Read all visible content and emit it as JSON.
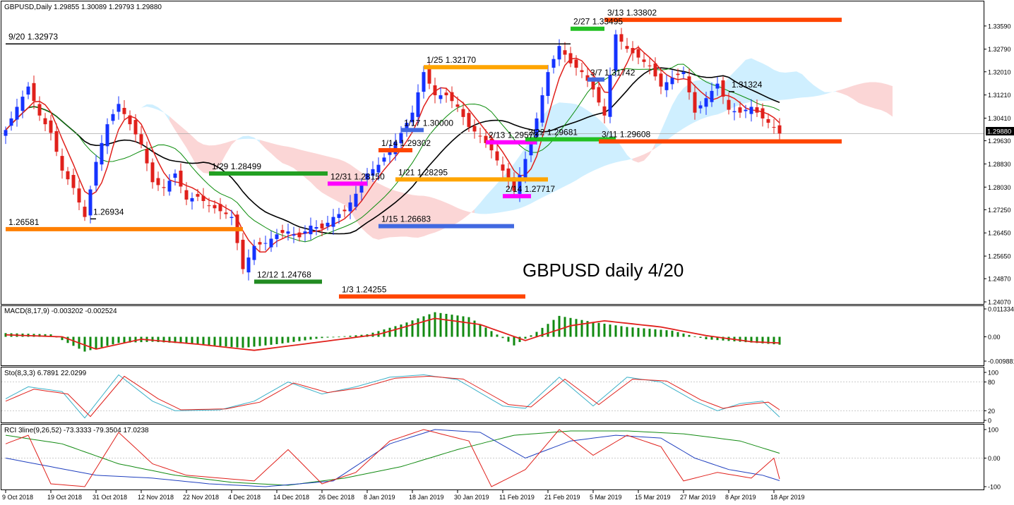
{
  "colors": {
    "bull": "#1533ff",
    "bear": "#e0201b",
    "tenkan": "#e0201b",
    "kijun": "#0b8c0b",
    "ma": "#000000",
    "kumo_bull": "#cfefff",
    "kumo_bear": "#fbd6d6",
    "macd_hist": "#118a11",
    "macd_signal": "#e0201b",
    "sto_k": "#3ab0c8",
    "sto_d": "#e0201b",
    "rci_short": "#e0201b",
    "rci_mid": "#1f3fbf",
    "rci_long": "#118a11"
  },
  "header": {
    "main": "GBPUSD,Daily  1.29855 1.30089 1.29793 1.29880",
    "macd": "MACD(8,17,9) -0.003202 -0.002524",
    "sto": "Sto(8,3,3) 6.7891 22.0299",
    "rci": "RCI 3line(9,26,52) -73.3333 -79.3504 17.0238"
  },
  "watermark": "GBPUSD daily 4/20",
  "current_price": "1.29880",
  "chart_data": [
    {
      "type": "candlestick",
      "panel": "main",
      "ylim": [
        1.2407,
        1.34
      ],
      "y_ticks": [
        "1.33590",
        "1.32790",
        "1.32010",
        "1.31210",
        "1.30410",
        "1.29630",
        "1.28830",
        "1.28030",
        "1.27250",
        "1.26450",
        "1.25650",
        "1.24870",
        "1.24070"
      ],
      "tick_values": [
        1.3359,
        1.3279,
        1.3201,
        1.3121,
        1.3041,
        1.2963,
        1.2883,
        1.2803,
        1.2725,
        1.2645,
        1.2565,
        1.2487,
        1.2407
      ],
      "x_ticks": [
        "9 Oct 2018",
        "19 Oct 2018",
        "31 Oct 2018",
        "12 Nov 2018",
        "22 Nov 2018",
        "4 Dec 2018",
        "14 Dec 2018",
        "26 Dec 2018",
        "8 Jan 2019",
        "18 Jan 2019",
        "30 Jan 2019",
        "11 Feb 2019",
        "21 Feb 2019",
        "5 Mar 2019",
        "15 Mar 2019",
        "27 Mar 2019",
        "8 Apr 2019",
        "18 Apr 2019"
      ],
      "x_tick_index": [
        0,
        8,
        16,
        24,
        32,
        40,
        48,
        56,
        64,
        72,
        80,
        88,
        96,
        104,
        112,
        120,
        128,
        136
      ],
      "close_path": [
        [
          0,
          1.3
        ],
        [
          2,
          1.308
        ],
        [
          4,
          1.315
        ],
        [
          6,
          1.305
        ],
        [
          8,
          1.299
        ],
        [
          10,
          1.286
        ],
        [
          12,
          1.28
        ],
        [
          14,
          1.27
        ],
        [
          16,
          1.289
        ],
        [
          18,
          1.302
        ],
        [
          20,
          1.309
        ],
        [
          22,
          1.302
        ],
        [
          24,
          1.295
        ],
        [
          26,
          1.282
        ],
        [
          28,
          1.28
        ],
        [
          30,
          1.285
        ],
        [
          32,
          1.276
        ],
        [
          34,
          1.277
        ],
        [
          36,
          1.274
        ],
        [
          38,
          1.272
        ],
        [
          40,
          1.27
        ],
        [
          42,
          1.252
        ],
        [
          44,
          1.26
        ],
        [
          46,
          1.261
        ],
        [
          48,
          1.264
        ],
        [
          50,
          1.265
        ],
        [
          52,
          1.263
        ],
        [
          54,
          1.267
        ],
        [
          56,
          1.266
        ],
        [
          58,
          1.27
        ],
        [
          60,
          1.272
        ],
        [
          62,
          1.278
        ],
        [
          64,
          1.285
        ],
        [
          66,
          1.288
        ],
        [
          68,
          1.293
        ],
        [
          70,
          1.299
        ],
        [
          72,
          1.306
        ],
        [
          74,
          1.32
        ],
        [
          76,
          1.312
        ],
        [
          78,
          1.312
        ],
        [
          80,
          1.308
        ],
        [
          82,
          1.301
        ],
        [
          84,
          1.298
        ],
        [
          86,
          1.293
        ],
        [
          88,
          1.286
        ],
        [
          90,
          1.279
        ],
        [
          92,
          1.29
        ],
        [
          94,
          1.304
        ],
        [
          96,
          1.32
        ],
        [
          98,
          1.329
        ],
        [
          100,
          1.323
        ],
        [
          102,
          1.32
        ],
        [
          104,
          1.314
        ],
        [
          106,
          1.305
        ],
        [
          108,
          1.333
        ],
        [
          110,
          1.328
        ],
        [
          112,
          1.325
        ],
        [
          114,
          1.322
        ],
        [
          116,
          1.315
        ],
        [
          118,
          1.318
        ],
        [
          120,
          1.32
        ],
        [
          122,
          1.306
        ],
        [
          124,
          1.311
        ],
        [
          126,
          1.316
        ],
        [
          128,
          1.307
        ],
        [
          130,
          1.306
        ],
        [
          132,
          1.308
        ],
        [
          134,
          1.304
        ],
        [
          136,
          1.301
        ],
        [
          137,
          1.2988
        ]
      ],
      "levels": [
        {
          "label": "9/20 1.32973",
          "value": 1.32973,
          "from": 0,
          "to": 100,
          "color": "#000000"
        },
        {
          "label": "3/13 1.33802",
          "value": 1.33802,
          "from": 106,
          "to": 148,
          "color": "#ff4500"
        },
        {
          "label": "2/27 1.33495",
          "value": 1.33495,
          "from": 100,
          "to": 106,
          "color": "#22c022"
        },
        {
          "label": "1/25 1.32170",
          "value": 1.3217,
          "from": 74,
          "to": 96,
          "color": "#ffa500"
        },
        {
          "label": "3/7 1.31742",
          "value": 1.31742,
          "from": 103,
          "to": 106,
          "color": "#4169e1"
        },
        {
          "label": "1.31324",
          "value": 1.31324,
          "from": 128,
          "to": 129,
          "color": "#000000"
        },
        {
          "label": "1/17 1.30000",
          "value": 1.3,
          "from": 70,
          "to": 74,
          "color": "#4169e1"
        },
        {
          "label": "2/13 1.29578",
          "value": 1.29578,
          "from": 85,
          "to": 94,
          "color": "#ff00ff"
        },
        {
          "label": "2/22 1.29681",
          "value": 1.29681,
          "from": 92,
          "to": 108,
          "color": "#22c022"
        },
        {
          "label": "3/11 1.29608",
          "value": 1.29608,
          "from": 105,
          "to": 148,
          "color": "#ff4500"
        },
        {
          "label": "1/14 1.29302",
          "value": 1.29302,
          "from": 66,
          "to": 72,
          "color": "#ff4500"
        },
        {
          "label": "1/29 1.28499",
          "value": 1.28499,
          "from": 36,
          "to": 57,
          "color": "#22a022"
        },
        {
          "label": "1/21 1.28295",
          "value": 1.28295,
          "from": 69,
          "to": 96,
          "color": "#ffa500"
        },
        {
          "label": "12/31 1.28150",
          "value": 1.2815,
          "from": 57,
          "to": 64,
          "color": "#ff00ff"
        },
        {
          "label": "2/14 1.27717",
          "value": 1.27717,
          "from": 88,
          "to": 93,
          "color": "#ff00ff"
        },
        {
          "label": "1.26934",
          "value": 1.26934,
          "from": 15,
          "to": 16,
          "color": "#000000"
        },
        {
          "label": "1.26581",
          "value": 1.26581,
          "from": 0,
          "to": 42,
          "color": "#ff7f00"
        },
        {
          "label": "1/15 1.26683",
          "value": 1.26683,
          "from": 66,
          "to": 90,
          "color": "#4169e1"
        },
        {
          "label": "12/12 1.24768",
          "value": 1.24768,
          "from": 44,
          "to": 56,
          "color": "#228b22"
        },
        {
          "label": "1/3 1.24255",
          "value": 1.24255,
          "from": 59,
          "to": 92,
          "color": "#ff4500"
        }
      ]
    },
    {
      "type": "histogram",
      "panel": "macd",
      "ylim": [
        -0.009881,
        0.011334
      ],
      "y_ticks": [
        "0.011334",
        "0.00",
        "-0.009881"
      ],
      "tick_values": [
        0.011334,
        0,
        -0.009881
      ],
      "hist_path": [
        [
          0,
          0.0015
        ],
        [
          8,
          0.001
        ],
        [
          14,
          -0.006
        ],
        [
          20,
          -0.0025
        ],
        [
          26,
          -0.002
        ],
        [
          34,
          -0.003
        ],
        [
          42,
          -0.0045
        ],
        [
          48,
          -0.003
        ],
        [
          56,
          -0.0005
        ],
        [
          64,
          0.001
        ],
        [
          70,
          0.005
        ],
        [
          76,
          0.01
        ],
        [
          82,
          0.008
        ],
        [
          88,
          -0.0005
        ],
        [
          90,
          -0.0035
        ],
        [
          94,
          0.002
        ],
        [
          98,
          0.0085
        ],
        [
          104,
          0.006
        ],
        [
          110,
          0.004
        ],
        [
          118,
          0.0025
        ],
        [
          124,
          -0.001
        ],
        [
          130,
          -0.002
        ],
        [
          137,
          -0.0032
        ]
      ],
      "signal_path": [
        [
          0,
          0.0008
        ],
        [
          10,
          0.0
        ],
        [
          16,
          -0.005
        ],
        [
          24,
          -0.001
        ],
        [
          34,
          -0.003
        ],
        [
          44,
          -0.0055
        ],
        [
          56,
          -0.002
        ],
        [
          66,
          0.001
        ],
        [
          76,
          0.0075
        ],
        [
          84,
          0.005
        ],
        [
          92,
          -0.0015
        ],
        [
          100,
          0.0045
        ],
        [
          106,
          0.0065
        ],
        [
          116,
          0.004
        ],
        [
          124,
          0.0005
        ],
        [
          132,
          -0.002
        ],
        [
          137,
          -0.0025
        ]
      ]
    },
    {
      "type": "line",
      "panel": "sto",
      "ylim": [
        0,
        100
      ],
      "y_ticks": [
        "100",
        "80",
        "20",
        "0"
      ],
      "tick_values": [
        100,
        80,
        20,
        0
      ],
      "k_path": [
        [
          0,
          45
        ],
        [
          4,
          70
        ],
        [
          10,
          60
        ],
        [
          14,
          5
        ],
        [
          20,
          95
        ],
        [
          26,
          40
        ],
        [
          30,
          20
        ],
        [
          38,
          22
        ],
        [
          44,
          40
        ],
        [
          50,
          80
        ],
        [
          56,
          55
        ],
        [
          62,
          70
        ],
        [
          68,
          90
        ],
        [
          74,
          95
        ],
        [
          80,
          85
        ],
        [
          88,
          30
        ],
        [
          92,
          25
        ],
        [
          98,
          90
        ],
        [
          104,
          30
        ],
        [
          110,
          90
        ],
        [
          116,
          80
        ],
        [
          122,
          40
        ],
        [
          126,
          20
        ],
        [
          130,
          35
        ],
        [
          134,
          40
        ],
        [
          137,
          7
        ]
      ],
      "d_path": [
        [
          0,
          40
        ],
        [
          5,
          65
        ],
        [
          11,
          55
        ],
        [
          15,
          8
        ],
        [
          21,
          92
        ],
        [
          27,
          45
        ],
        [
          31,
          22
        ],
        [
          39,
          24
        ],
        [
          45,
          38
        ],
        [
          51,
          78
        ],
        [
          57,
          58
        ],
        [
          63,
          68
        ],
        [
          69,
          88
        ],
        [
          75,
          92
        ],
        [
          81,
          86
        ],
        [
          89,
          33
        ],
        [
          93,
          28
        ],
        [
          99,
          86
        ],
        [
          105,
          33
        ],
        [
          111,
          86
        ],
        [
          117,
          82
        ],
        [
          123,
          43
        ],
        [
          127,
          25
        ],
        [
          131,
          33
        ],
        [
          135,
          38
        ],
        [
          137,
          22
        ]
      ]
    },
    {
      "type": "line",
      "panel": "rci",
      "ylim": [
        -100,
        100
      ],
      "y_ticks": [
        "100",
        "0.00",
        "-100"
      ],
      "tick_values": [
        100,
        0,
        -100
      ],
      "short_path": [
        [
          0,
          50
        ],
        [
          4,
          80
        ],
        [
          8,
          -90
        ],
        [
          14,
          -100
        ],
        [
          20,
          90
        ],
        [
          26,
          -20
        ],
        [
          32,
          -60
        ],
        [
          38,
          -70
        ],
        [
          44,
          -80
        ],
        [
          50,
          30
        ],
        [
          56,
          -90
        ],
        [
          62,
          -50
        ],
        [
          68,
          60
        ],
        [
          74,
          100
        ],
        [
          82,
          60
        ],
        [
          86,
          -100
        ],
        [
          92,
          -40
        ],
        [
          98,
          100
        ],
        [
          104,
          10
        ],
        [
          110,
          80
        ],
        [
          116,
          40
        ],
        [
          120,
          -80
        ],
        [
          126,
          -50
        ],
        [
          132,
          -70
        ],
        [
          136,
          0
        ],
        [
          137,
          -73
        ]
      ],
      "mid_path": [
        [
          0,
          0
        ],
        [
          8,
          -30
        ],
        [
          16,
          -60
        ],
        [
          26,
          -70
        ],
        [
          36,
          -90
        ],
        [
          46,
          -100
        ],
        [
          58,
          -80
        ],
        [
          68,
          50
        ],
        [
          76,
          100
        ],
        [
          84,
          90
        ],
        [
          92,
          0
        ],
        [
          100,
          60
        ],
        [
          108,
          80
        ],
        [
          116,
          70
        ],
        [
          122,
          0
        ],
        [
          128,
          -40
        ],
        [
          134,
          -60
        ],
        [
          137,
          -79
        ]
      ],
      "long_path": [
        [
          0,
          80
        ],
        [
          10,
          50
        ],
        [
          20,
          -20
        ],
        [
          30,
          -60
        ],
        [
          40,
          -85
        ],
        [
          50,
          -95
        ],
        [
          60,
          -70
        ],
        [
          70,
          -30
        ],
        [
          80,
          30
        ],
        [
          90,
          80
        ],
        [
          100,
          95
        ],
        [
          110,
          95
        ],
        [
          120,
          85
        ],
        [
          130,
          60
        ],
        [
          137,
          17
        ]
      ]
    }
  ]
}
